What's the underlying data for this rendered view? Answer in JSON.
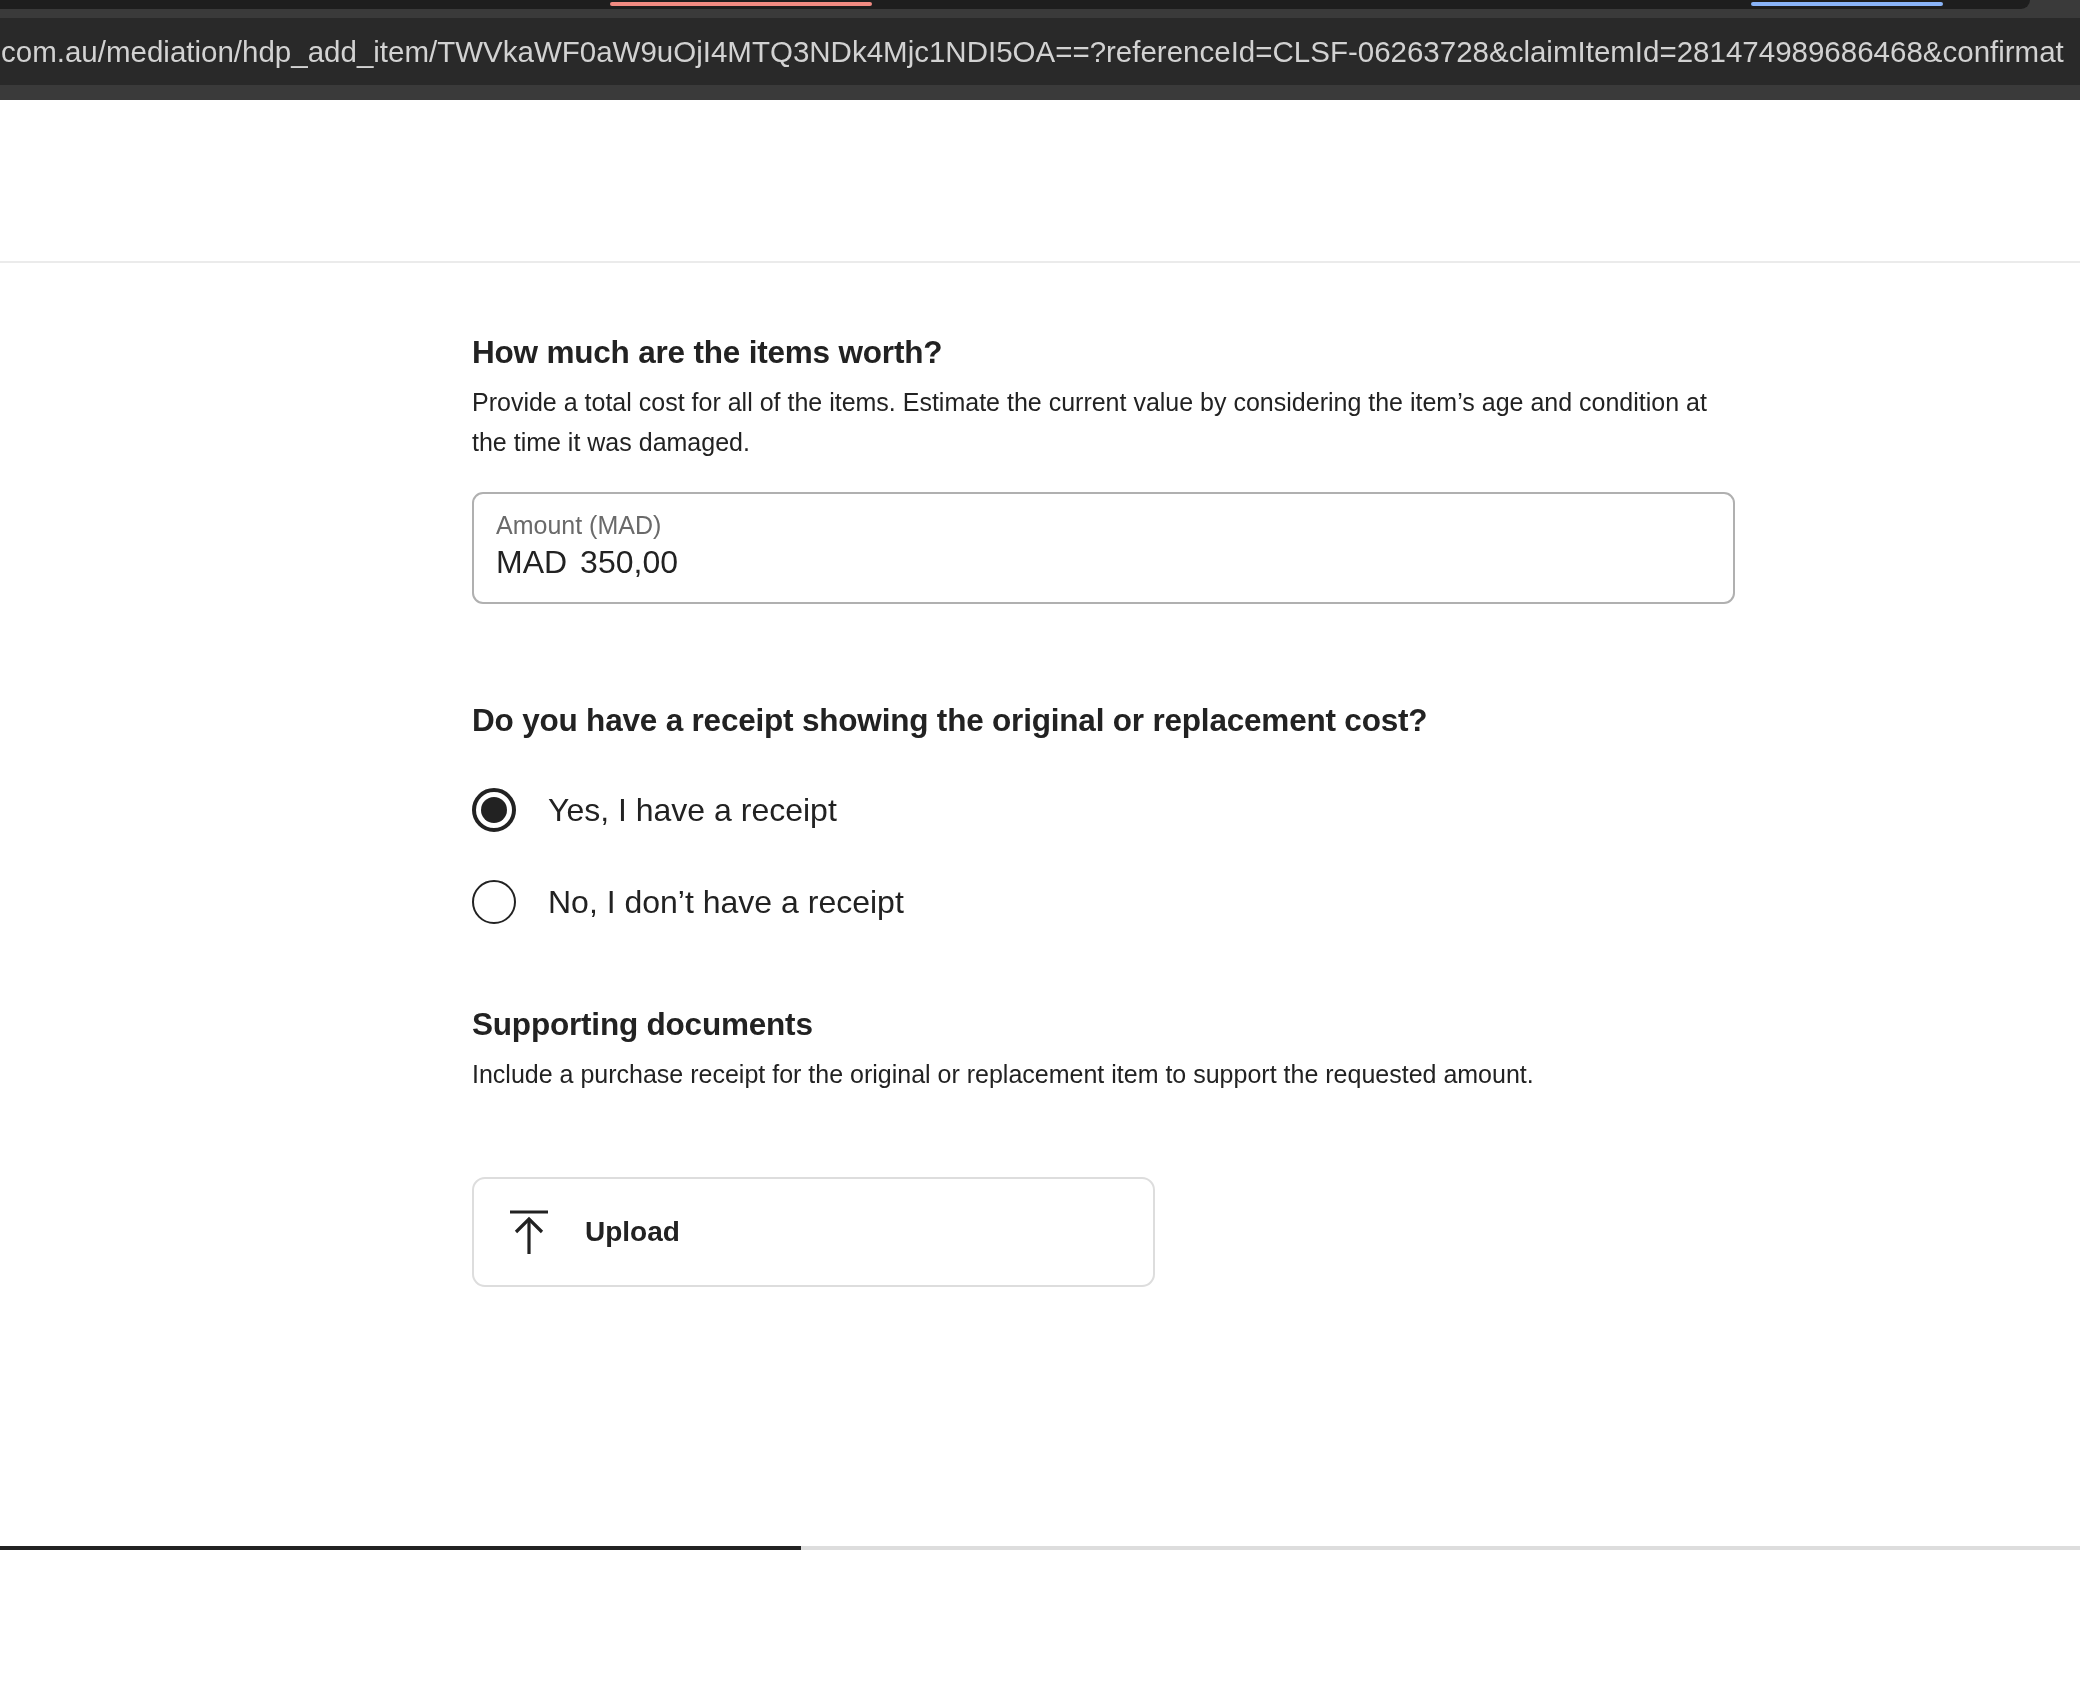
{
  "browser": {
    "url": "com.au/mediation/hdp_add_item/TWVkaWF0aW9uOjI4MTQ3NDk4Mjc1NDI5OA==?referenceId=CLSF-06263728&claimItemId=281474989686468&confirmat"
  },
  "worth": {
    "heading": "How much are the items worth?",
    "description": "Provide a total cost for all of the items. Estimate the current value by considering the item’s age and condition at the time it was damaged.",
    "amount_field": {
      "label": "Amount (MAD)",
      "prefix": "MAD",
      "value": "350,00"
    }
  },
  "receipt": {
    "question": "Do you have a receipt showing the original or replacement cost?",
    "options": [
      {
        "label": "Yes, I have a receipt",
        "selected": true
      },
      {
        "label": "No, I don’t have a receipt",
        "selected": false
      }
    ]
  },
  "supporting_documents": {
    "heading": "Supporting documents",
    "description": "Include a purchase receipt for the original or replacement item to support the requested amount.",
    "upload_button": {
      "label": "Upload"
    }
  },
  "progress": {
    "level": 0.385
  }
}
